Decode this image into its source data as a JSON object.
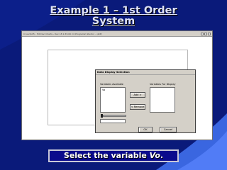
{
  "slide": {
    "title_line1": "Example 1 – 1st Order",
    "title_line2": "System",
    "caption_prefix": "Select the variable ",
    "caption_var": "Vo",
    "caption_suffix": "."
  },
  "app": {
    "title": "C:\\usr\\bdf\\ - Hill Dec Charts - Dec 18 1:39:00: C:\\Programs\\ Studio\\ ...\\bdf\\"
  },
  "dialog": {
    "title": "Data Display Selection",
    "variables_available_label": "Variables Available",
    "variables_display_label": "Variables For Display",
    "available_items": [
      "Vo"
    ],
    "add_label": "Add >",
    "remove_label": "< Remove",
    "ok_label": "OK",
    "cancel_label": "Cancel"
  }
}
